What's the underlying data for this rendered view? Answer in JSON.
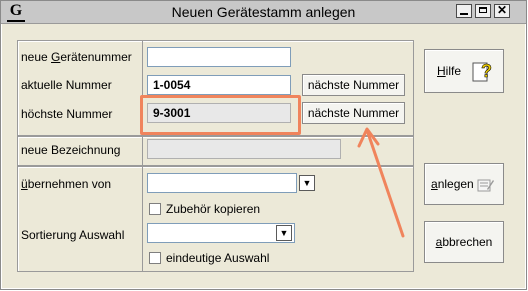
{
  "window": {
    "title": "Neuen Gerätestamm anlegen",
    "icon_letter": "G"
  },
  "fields": {
    "new_device_number": {
      "label_pre": "neue ",
      "label_u": "G",
      "label_post": "erätenummer",
      "value": ""
    },
    "current_number": {
      "label": "aktuelle Nummer",
      "value": "1-0054",
      "button": "nächste Nummer"
    },
    "highest_number": {
      "label": "höchste Nummer",
      "value": "9-3001",
      "button": "nächste Nummer"
    },
    "new_description": {
      "label": "neue Bezeichnung",
      "value": ""
    },
    "take_over_from": {
      "label_u": "ü",
      "label_post": "bernehmen von",
      "value": ""
    },
    "copy_accessories": {
      "label": "Zubehör kopieren",
      "checked": false
    },
    "sort_selection": {
      "label": "Sortierung Auswahl",
      "value": ""
    },
    "unique_selection": {
      "label": "eindeutige Auswahl",
      "checked": false
    }
  },
  "buttons": {
    "help": {
      "label_u": "H",
      "label_post": "ilfe"
    },
    "create": {
      "label_u": "a",
      "label_post": "nlegen"
    },
    "cancel": {
      "label_u": "a",
      "label_post": "bbrechen"
    }
  },
  "annotation": {
    "highlight_color": "#f0845c",
    "icons": [
      "help-question-icon",
      "create-icon",
      "chevron-down-icon",
      "annotation-arrow-icon"
    ]
  }
}
